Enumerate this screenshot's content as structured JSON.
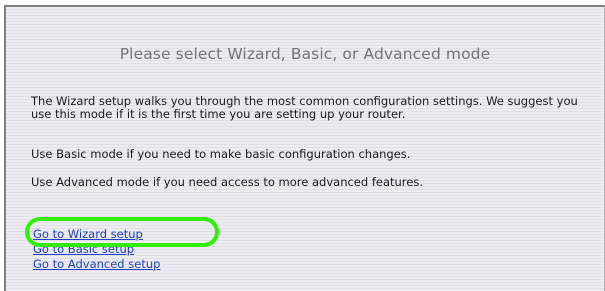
{
  "heading": "Please select Wizard, Basic, or Advanced mode",
  "paragraphs": {
    "wizard": "The Wizard setup walks you through the most common configuration settings. We suggest you use this mode if it is the first time you are setting up your router.",
    "basic": "Use Basic mode if you need to make basic configuration changes.",
    "advanced": "Use Advanced mode if you need access to more advanced features."
  },
  "links": {
    "wizard": "Go to Wizard setup",
    "basic": "Go to Basic setup",
    "advanced": "Go to Advanced setup"
  },
  "colors": {
    "link": "#1f3fc4",
    "highlight": "#33ee0a",
    "heading": "#747474"
  }
}
